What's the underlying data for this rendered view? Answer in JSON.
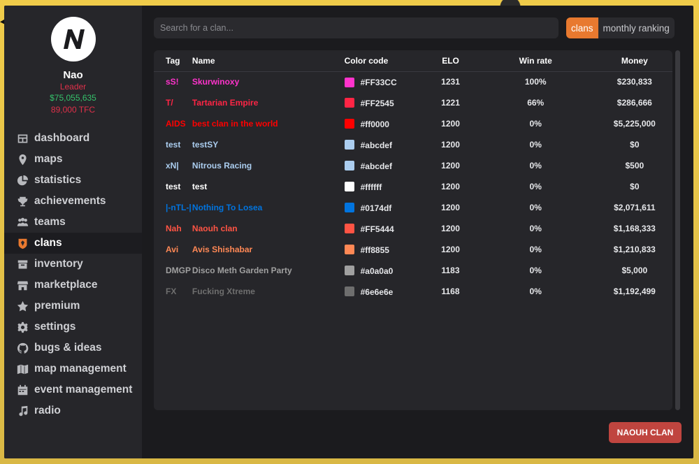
{
  "profile": {
    "name": "Nao",
    "role": "Leader",
    "money": "$75,055,635",
    "tfc": "89,000 TFC"
  },
  "nav": [
    {
      "label": "dashboard",
      "icon": "dashboard-icon"
    },
    {
      "label": "maps",
      "icon": "map-pin-icon"
    },
    {
      "label": "statistics",
      "icon": "pie-chart-icon"
    },
    {
      "label": "achievements",
      "icon": "trophy-icon"
    },
    {
      "label": "teams",
      "icon": "users-icon"
    },
    {
      "label": "clans",
      "icon": "clan-shield-icon",
      "active": true
    },
    {
      "label": "inventory",
      "icon": "inventory-icon"
    },
    {
      "label": "marketplace",
      "icon": "store-icon"
    },
    {
      "label": "premium",
      "icon": "star-icon"
    },
    {
      "label": "settings",
      "icon": "gear-icon"
    },
    {
      "label": "bugs & ideas",
      "icon": "github-icon"
    },
    {
      "label": "map management",
      "icon": "map-manage-icon"
    },
    {
      "label": "event management",
      "icon": "calendar-icon"
    },
    {
      "label": "radio",
      "icon": "music-note-icon"
    }
  ],
  "search": {
    "placeholder": "Search for a clan..."
  },
  "tabs": {
    "clans": "clans",
    "monthly": "monthly ranking"
  },
  "table": {
    "headers": {
      "tag": "Tag",
      "name": "Name",
      "color": "Color code",
      "elo": "ELO",
      "win": "Win rate",
      "money": "Money"
    },
    "rows": [
      {
        "tag": "sS!",
        "name": "Skurwinoxy",
        "color": "#FF33CC",
        "elo": "1231",
        "win": "100%",
        "money": "$230,833"
      },
      {
        "tag": "T/",
        "name": "Tartarian Empire",
        "color": "#FF2545",
        "elo": "1221",
        "win": "66%",
        "money": "$286,666"
      },
      {
        "tag": "AIDS",
        "name": "best clan in the world",
        "color": "#ff0000",
        "elo": "1200",
        "win": "0%",
        "money": "$5,225,000"
      },
      {
        "tag": "test",
        "name": "testSY",
        "color": "#abcdef",
        "elo": "1200",
        "win": "0%",
        "money": "$0"
      },
      {
        "tag": "xN|",
        "name": "Nitrous Racing",
        "color": "#abcdef",
        "elo": "1200",
        "win": "0%",
        "money": "$500"
      },
      {
        "tag": "test",
        "name": "test",
        "color": "#ffffff",
        "elo": "1200",
        "win": "0%",
        "money": "$0"
      },
      {
        "tag": "|-nTL-|",
        "name": "Nothing To Losea",
        "color": "#0174df",
        "elo": "1200",
        "win": "0%",
        "money": "$2,071,611"
      },
      {
        "tag": "Nah",
        "name": "Naouh clan",
        "color": "#FF5444",
        "elo": "1200",
        "win": "0%",
        "money": "$1,168,333"
      },
      {
        "tag": "Avi",
        "name": "Avis Shishabar",
        "color": "#ff8855",
        "elo": "1200",
        "win": "0%",
        "money": "$1,210,833"
      },
      {
        "tag": "DMGP",
        "name": "Disco Meth Garden Party",
        "color": "#a0a0a0",
        "elo": "1183",
        "win": "0%",
        "money": "$5,000"
      },
      {
        "tag": "FX",
        "name": "Fucking Xtreme",
        "color": "#6e6e6e",
        "elo": "1168",
        "win": "0%",
        "money": "$1,192,499"
      }
    ]
  },
  "footer": {
    "button": "NAOUH CLAN"
  },
  "colors": {
    "accent": "#e8792f",
    "danger": "#c0453f",
    "positive": "#35c26b",
    "role": "#e0304a"
  }
}
